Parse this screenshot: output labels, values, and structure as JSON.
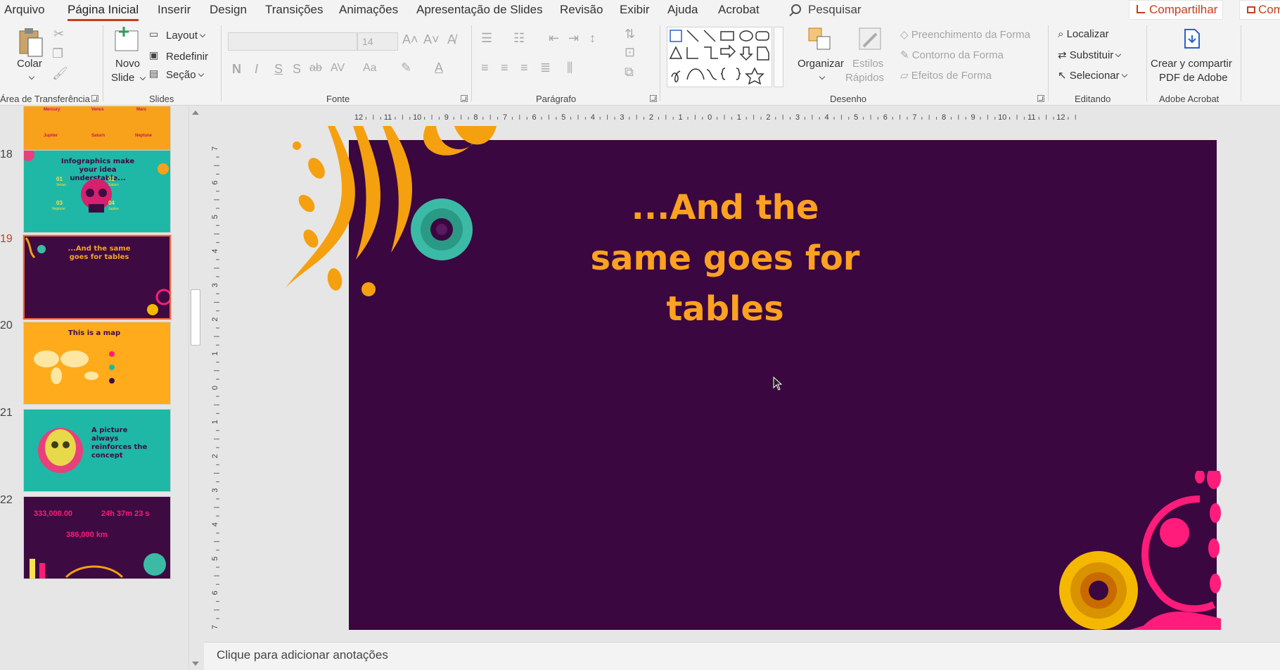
{
  "tabs": [
    "Arquivo",
    "Página Inicial",
    "Inserir",
    "Design",
    "Transições",
    "Animações",
    "Apresentação de Slides",
    "Revisão",
    "Exibir",
    "Ajuda",
    "Acrobat"
  ],
  "active_tab": "Página Inicial",
  "search_label": "Pesquisar",
  "share_label": "Compartilhar",
  "comments_label": "Com",
  "ribbon": {
    "clipboard": {
      "paste": "Colar",
      "group": "Área de Transferência"
    },
    "slides": {
      "new_slide_1": "Novo",
      "new_slide_2": "Slide",
      "layout": "Layout",
      "reset": "Redefinir",
      "section": "Seção",
      "group": "Slides"
    },
    "font": {
      "size": "14",
      "bold": "N",
      "italic": "I",
      "underline": "S",
      "shadow": "S",
      "strike": "ab",
      "spacing": "AV",
      "case": "Aa",
      "group": "Fonte"
    },
    "paragraph": {
      "group": "Parágrafo"
    },
    "drawing": {
      "arrange": "Organizar",
      "styles_1": "Estilos",
      "styles_2": "Rápidos",
      "fill": "Preenchimento da Forma",
      "outline": "Contorno da Forma",
      "effects": "Efeitos de Forma",
      "group": "Desenho"
    },
    "editing": {
      "find": "Localizar",
      "replace": "Substituir",
      "select": "Selecionar",
      "group": "Editando"
    },
    "acrobat": {
      "create_1": "Crear y compartir",
      "create_2": "PDF de Adobe",
      "group": "Adobe Acrobat"
    }
  },
  "slide_numbers": [
    "18",
    "19",
    "20",
    "21",
    "22"
  ],
  "thumbs": {
    "t17": {
      "labels": [
        "Mercury",
        "Venus",
        "Mars",
        "Jupiter",
        "Saturn",
        "Neptune"
      ]
    },
    "t18": {
      "title": "Infographics make your idea understable...",
      "nums": [
        "01",
        "02",
        "03",
        "04"
      ],
      "names": [
        "Venus",
        "Saturn",
        "Neptune",
        "Jupiter"
      ]
    },
    "t19": {
      "title": "...And the same goes for tables"
    },
    "t20": {
      "title": "This is a map"
    },
    "t21": {
      "title": "A picture always reinforces the concept"
    },
    "t22": {
      "big1": "333,000.00",
      "big2": "24h 37m 23 s",
      "big3": "386,000 km"
    }
  },
  "slide": {
    "title": "...And the same goes for tables",
    "background": "#3a0740",
    "accent_orange": "#fca121",
    "accent_pink": "#ff1c7a",
    "accent_teal": "#3bbba5"
  },
  "ruler": {
    "h_ticks": [
      "12",
      "11",
      "10",
      "9",
      "8",
      "7",
      "6",
      "5",
      "4",
      "3",
      "2",
      "1",
      "0",
      "1",
      "2",
      "3",
      "4",
      "5",
      "6",
      "7",
      "8",
      "9",
      "10",
      "11",
      "12"
    ],
    "v_ticks": [
      "7",
      "6",
      "5",
      "4",
      "3",
      "2",
      "1",
      "0",
      "1",
      "2",
      "3",
      "4",
      "5",
      "6",
      "7"
    ]
  },
  "notes_placeholder": "Clique para adicionar anotações"
}
